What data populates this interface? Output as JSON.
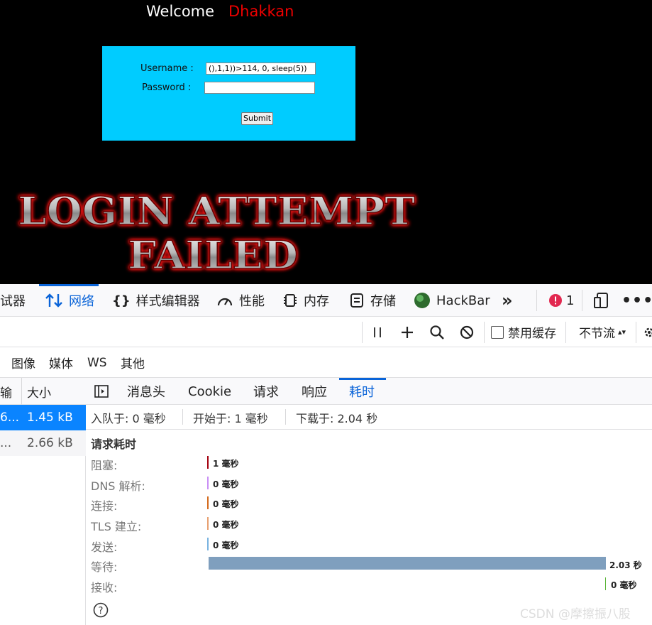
{
  "page": {
    "welcome": "Welcome",
    "user": "Dhakkan",
    "username_label": "Username :",
    "username_value": "(),1,1))>114, 0, sleep(5))",
    "password_label": "Password :",
    "password_value": "",
    "submit_label": "Submit",
    "failed_line1": "LOGIN ATTEMPT",
    "failed_line2": "FAILED"
  },
  "devtools": {
    "tabs": [
      "调试器",
      "网络",
      "样式编辑器",
      "性能",
      "内存",
      "存储",
      "HackBar"
    ],
    "error_count": "1",
    "disable_cache_label": "禁用缓存",
    "throttle_label": "不节流",
    "filters": [
      "图像",
      "媒体",
      "WS",
      "其他"
    ]
  },
  "request_list": {
    "columns": [
      "输",
      "大小"
    ],
    "rows": [
      {
        "transfer": "6...",
        "size": "1.45 kB"
      },
      {
        "transfer": "...",
        "size": "2.66 kB"
      }
    ]
  },
  "detail": {
    "tabs": [
      "消息头",
      "Cookie",
      "请求",
      "响应",
      "耗时"
    ],
    "summary": {
      "queued": "入队于:  0 毫秒",
      "started": "开始于:  1 毫秒",
      "downloaded": "下载于:  2.04 秒"
    },
    "section_title": "请求耗时",
    "timings": [
      {
        "label": "阻塞:",
        "value": "1 毫秒",
        "color": "#a4000f"
      },
      {
        "label": "DNS 解析:",
        "value": "0 毫秒",
        "color": "#c98ef5"
      },
      {
        "label": "连接:",
        "value": "0 毫秒",
        "color": "#d46a1c"
      },
      {
        "label": "TLS 建立:",
        "value": "0 毫秒",
        "color": "#e79f70"
      },
      {
        "label": "发送:",
        "value": "0 毫秒",
        "color": "#79b3e0"
      },
      {
        "label": "等待:",
        "value": "2.03 秒",
        "color": "#7f9fbe"
      },
      {
        "label": "接收:",
        "value": "0 毫秒",
        "color": "#58b436"
      }
    ]
  },
  "watermark": "CSDN @摩擦振八股"
}
